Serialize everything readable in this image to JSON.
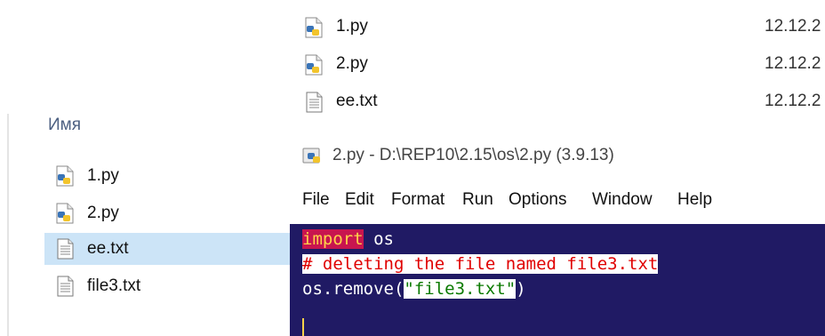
{
  "top_files": [
    {
      "name": "1.py",
      "date": "12.12.2",
      "icon": "python-file-icon"
    },
    {
      "name": "2.py",
      "date": "12.12.2",
      "icon": "python-file-icon"
    },
    {
      "name": "ee.txt",
      "date": "12.12.2",
      "icon": "text-file-icon"
    }
  ],
  "left_explorer": {
    "header": "Имя",
    "files": [
      {
        "name": "1.py",
        "icon": "python-file-icon"
      },
      {
        "name": "2.py",
        "icon": "python-file-icon"
      },
      {
        "name": "ee.txt",
        "icon": "text-file-icon",
        "selected": true
      },
      {
        "name": "file3.txt",
        "icon": "text-file-icon"
      }
    ]
  },
  "idle": {
    "title": "2.py - D:\\REP10\\2.15\\os\\2.py (3.9.13)",
    "menu": [
      "File",
      "Edit",
      "Format",
      "Run",
      "Options",
      "Window",
      "Help"
    ],
    "code": {
      "line1_keyword": "import",
      "line1_rest": " os",
      "line2_comment": "# deleting the file named file3.txt",
      "line3_prefix": "os.remove(",
      "line3_string": "\"file3.txt\"",
      "line3_suffix": ")"
    },
    "colors": {
      "editor_bg": "#201a64",
      "keyword_bg": "#c8154f",
      "keyword_fg": "#ffd24a",
      "comment_fg": "#e00000",
      "string_fg": "#0b7a00"
    }
  }
}
